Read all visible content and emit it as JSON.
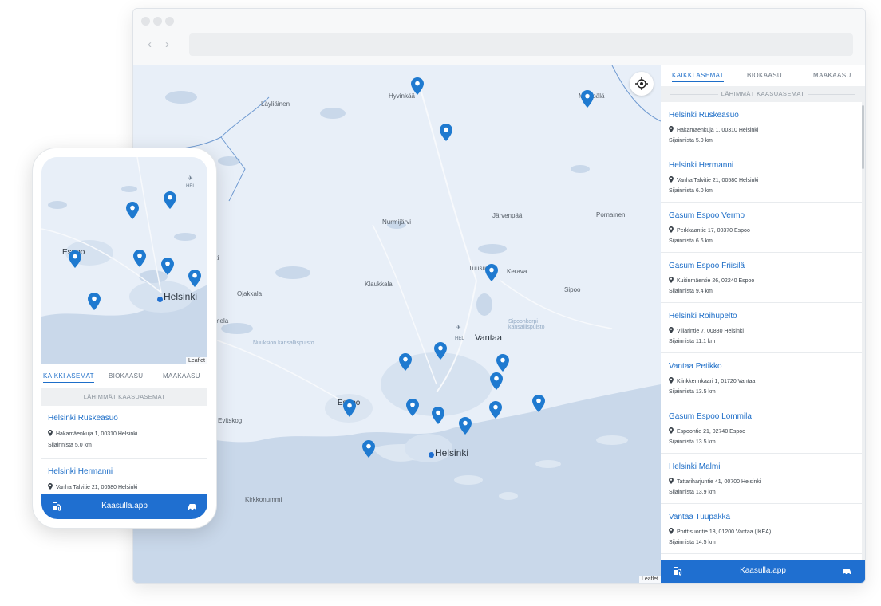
{
  "app_name": "Kaasulla.app",
  "colors": {
    "accent": "#1f6fd0",
    "link": "#1c6dc7",
    "map_water": "#c9d8ea",
    "map_land": "#e6eef8"
  },
  "tabs": [
    {
      "label": "KAIKKI ASEMAT",
      "active": true
    },
    {
      "label": "BIOKAASU",
      "active": false
    },
    {
      "label": "MAAKAASU",
      "active": false
    }
  ],
  "section_title": "LÄHIMMÄT KAASUASEMAT",
  "stations": [
    {
      "name": "Helsinki Ruskeasuo",
      "address": "Hakamäenkuja 1, 00310 Helsinki",
      "distance": "Sijainnista  5.0 km"
    },
    {
      "name": "Helsinki Hermanni",
      "address": "Vanha Talvitie 21, 00580 Helsinki",
      "distance": "Sijainnista  6.0 km"
    },
    {
      "name": "Gasum Espoo Vermo",
      "address": "Perkkaantie 17, 00370 Espoo",
      "distance": "Sijainnista  6.6 km"
    },
    {
      "name": "Gasum Espoo Friisilä",
      "address": "Kuitinmäentie 26, 02240 Espoo",
      "distance": "Sijainnista  9.4 km"
    },
    {
      "name": "Helsinki Roihupelto",
      "address": "Villarintie 7, 00880 Helsinki",
      "distance": "Sijainnista  11.1 km"
    },
    {
      "name": "Vantaa Petikko",
      "address": "Klinkkerinkaari 1, 01720 Vantaa",
      "distance": "Sijainnista  13.5 km"
    },
    {
      "name": "Gasum Espoo Lommila",
      "address": "Espoontie 21, 02740 Espoo",
      "distance": "Sijainnista  13.5 km"
    },
    {
      "name": "Helsinki Malmi",
      "address": "Tattariharjuntie 41, 00700 Helsinki",
      "distance": "Sijainnista  13.9 km"
    },
    {
      "name": "Vantaa Tuupakka",
      "address": "Porttisuontie 18, 01200 Vantaa (IKEA)",
      "distance": "Sijainnista  14.5 km"
    }
  ],
  "map_labels": {
    "hyvinkaa": "Hyvinkää",
    "mantsala": "Mäntsälä",
    "laylainen": "Läyliäinen",
    "nurmijarvi": "Nurmijärvi",
    "jarvenpaa": "Järvenpää",
    "pornainen": "Pornainen",
    "tuusula": "Tuusula",
    "kerava": "Kerava",
    "klaukkala": "Klaukkala",
    "sipoo": "Sipoo",
    "vantaa": "Vantaa",
    "hel": "HEL",
    "espoo": "Espoo",
    "helsinki": "Helsinki",
    "evitskog": "Evitskog",
    "kirkkonummi": "Kirkkonummi",
    "nuuksio": "Nuuksion kansallispuisto",
    "sipoonkorpi": "Sipoonkorpi kansallispuisto",
    "vihti": "Vihti",
    "ojakkala": "Ojakkala",
    "nummela": "Nummela"
  },
  "attribution": "Leaflet",
  "icons": {
    "locate": "crosshair-icon",
    "fuel": "fuel-pump-icon",
    "car": "car-icon",
    "pin": "map-pin-icon",
    "airport": "airplane-icon"
  }
}
